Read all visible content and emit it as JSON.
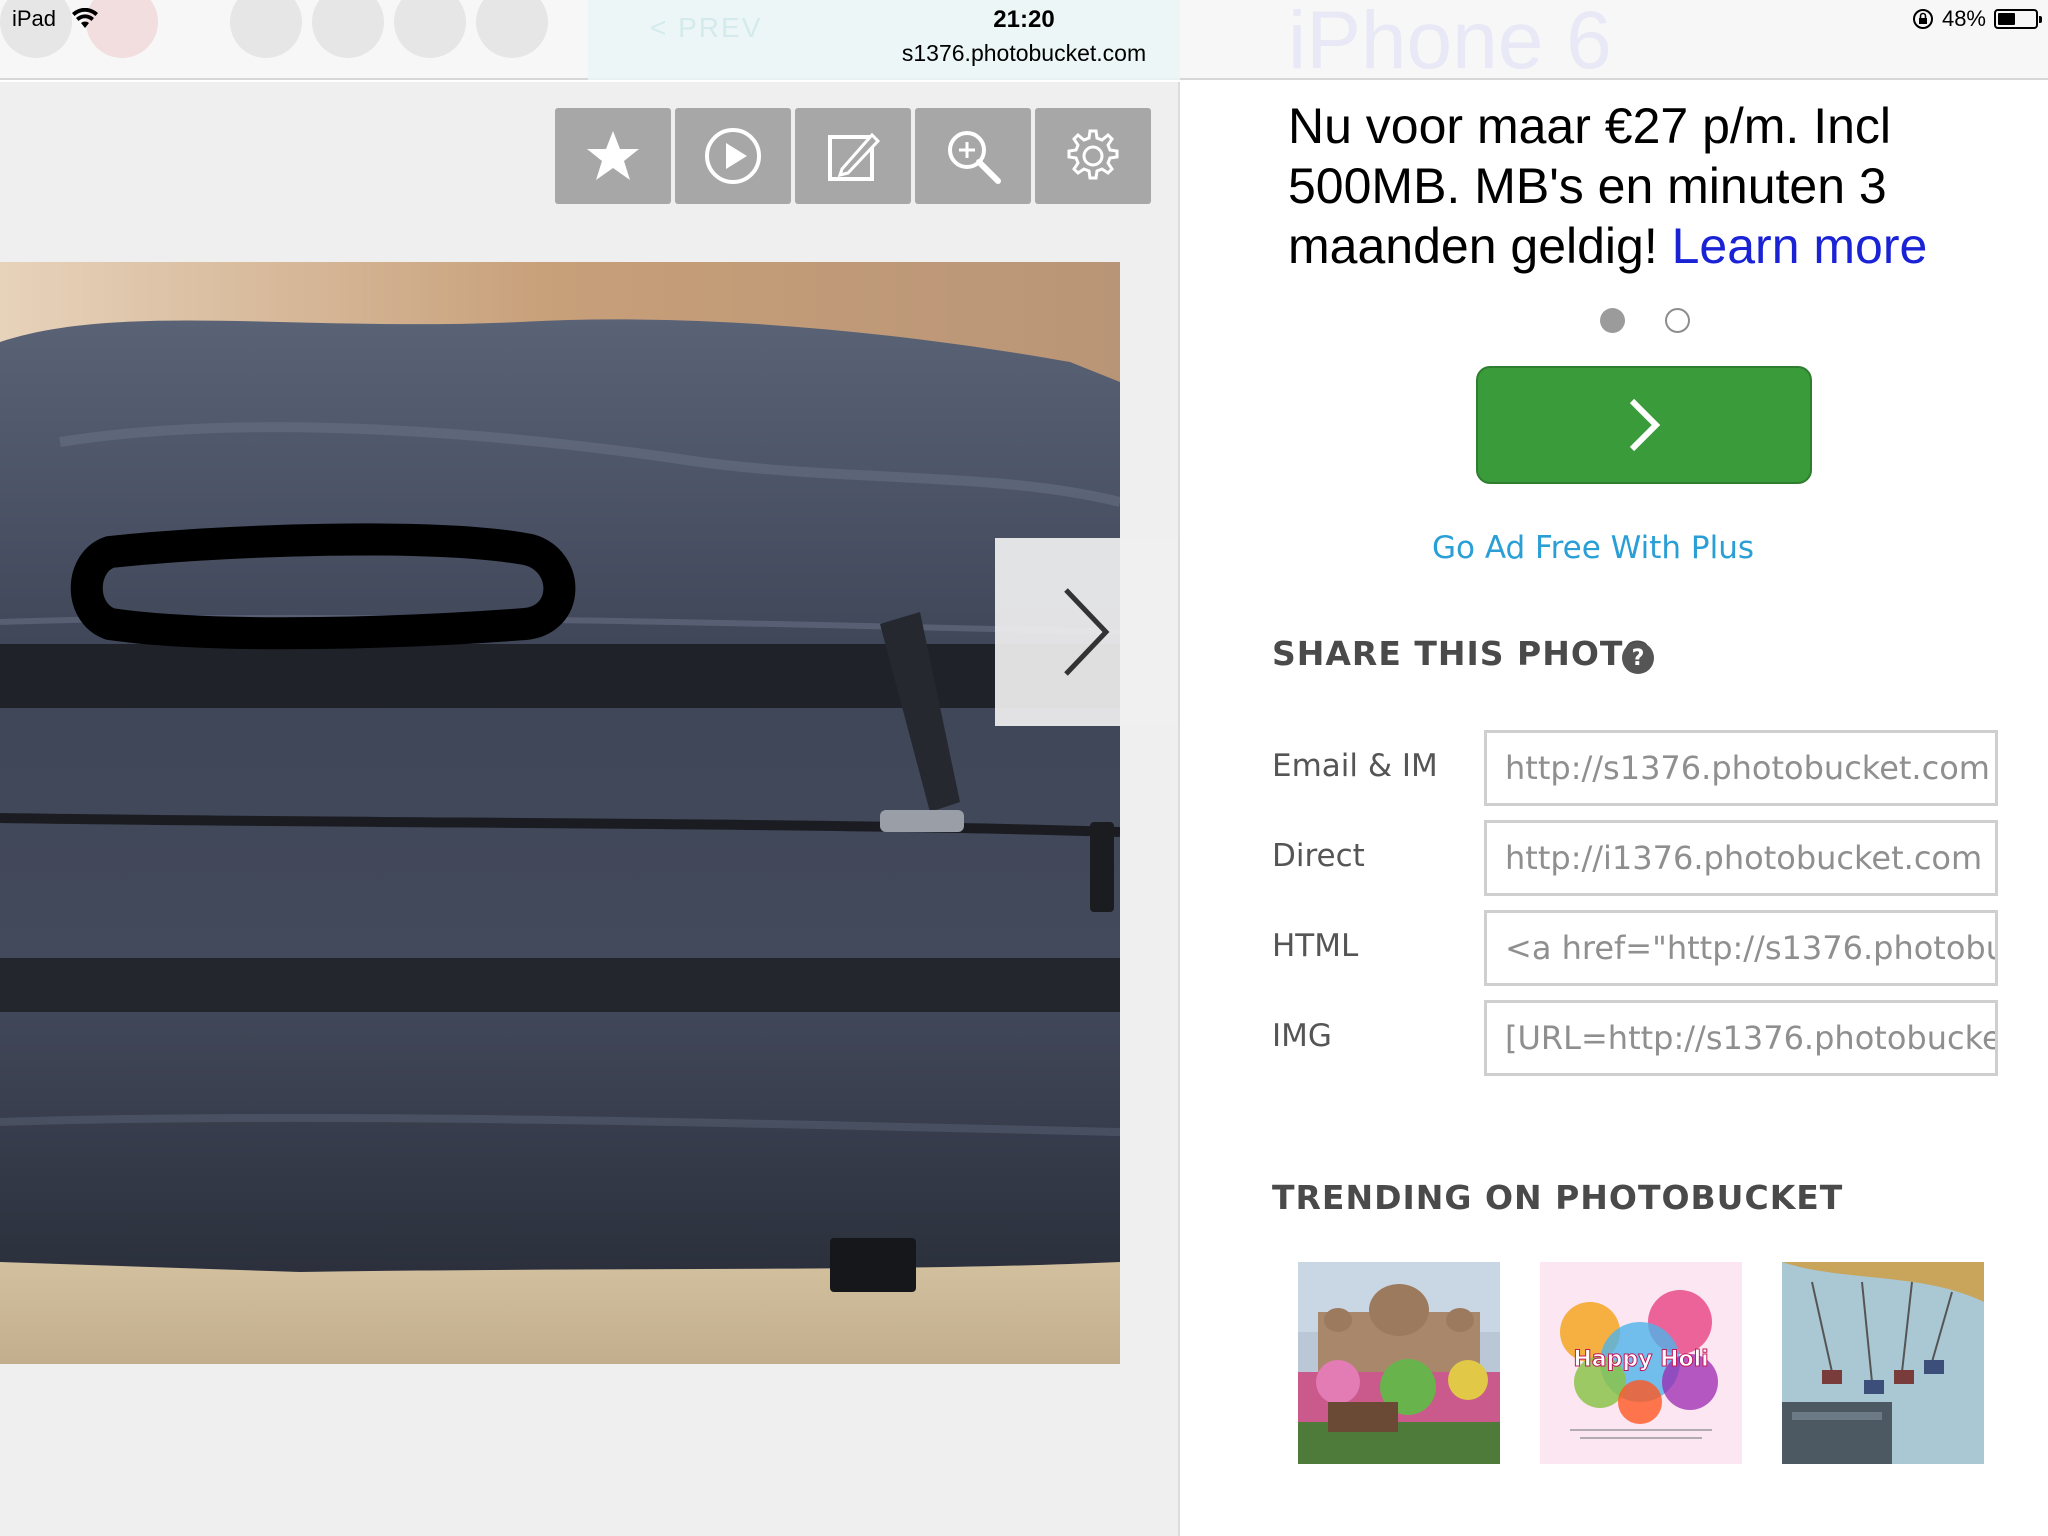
{
  "status_bar": {
    "device": "iPad",
    "time": "21:20",
    "url": "s1376.photobucket.com",
    "battery": "48%",
    "battery_level": 0.48
  },
  "background_header": {
    "prev_label": "< PREV",
    "brand_text": "iPhone 6"
  },
  "toolbar": {
    "buttons": [
      {
        "icon": "star-icon"
      },
      {
        "icon": "play-icon"
      },
      {
        "icon": "edit-icon"
      },
      {
        "icon": "zoom-in-icon"
      },
      {
        "icon": "settings-icon"
      }
    ]
  },
  "ad": {
    "text": "Nu voor maar €27 p/m. Incl 500MB. MB's en minuten 3 maanden geldig! ",
    "link_text": "Learn more",
    "carousel_active": 0,
    "carousel_count": 2
  },
  "ad_free_link": "Go Ad Free With Plus",
  "share": {
    "title": "SHARE THIS PHOTO",
    "help_icon_text": "?",
    "rows": [
      {
        "label": "Email & IM",
        "value": "http://s1376.photobucket.com"
      },
      {
        "label": "Direct",
        "value": "http://i1376.photobucket.com"
      },
      {
        "label": "HTML",
        "value": "<a href=\"http://s1376.photobu"
      },
      {
        "label": "IMG",
        "value": "[URL=http://s1376.photobucke"
      }
    ]
  },
  "trending": {
    "title": "TRENDING ON PHOTOBUCKET",
    "thumb_text": "Happy Holi"
  },
  "colors": {
    "green_button": "#3a9b3a",
    "link_blue": "#1a22d6",
    "adfree_blue": "#2a9fd6",
    "toolbar_gray": "#a7a7a7"
  }
}
